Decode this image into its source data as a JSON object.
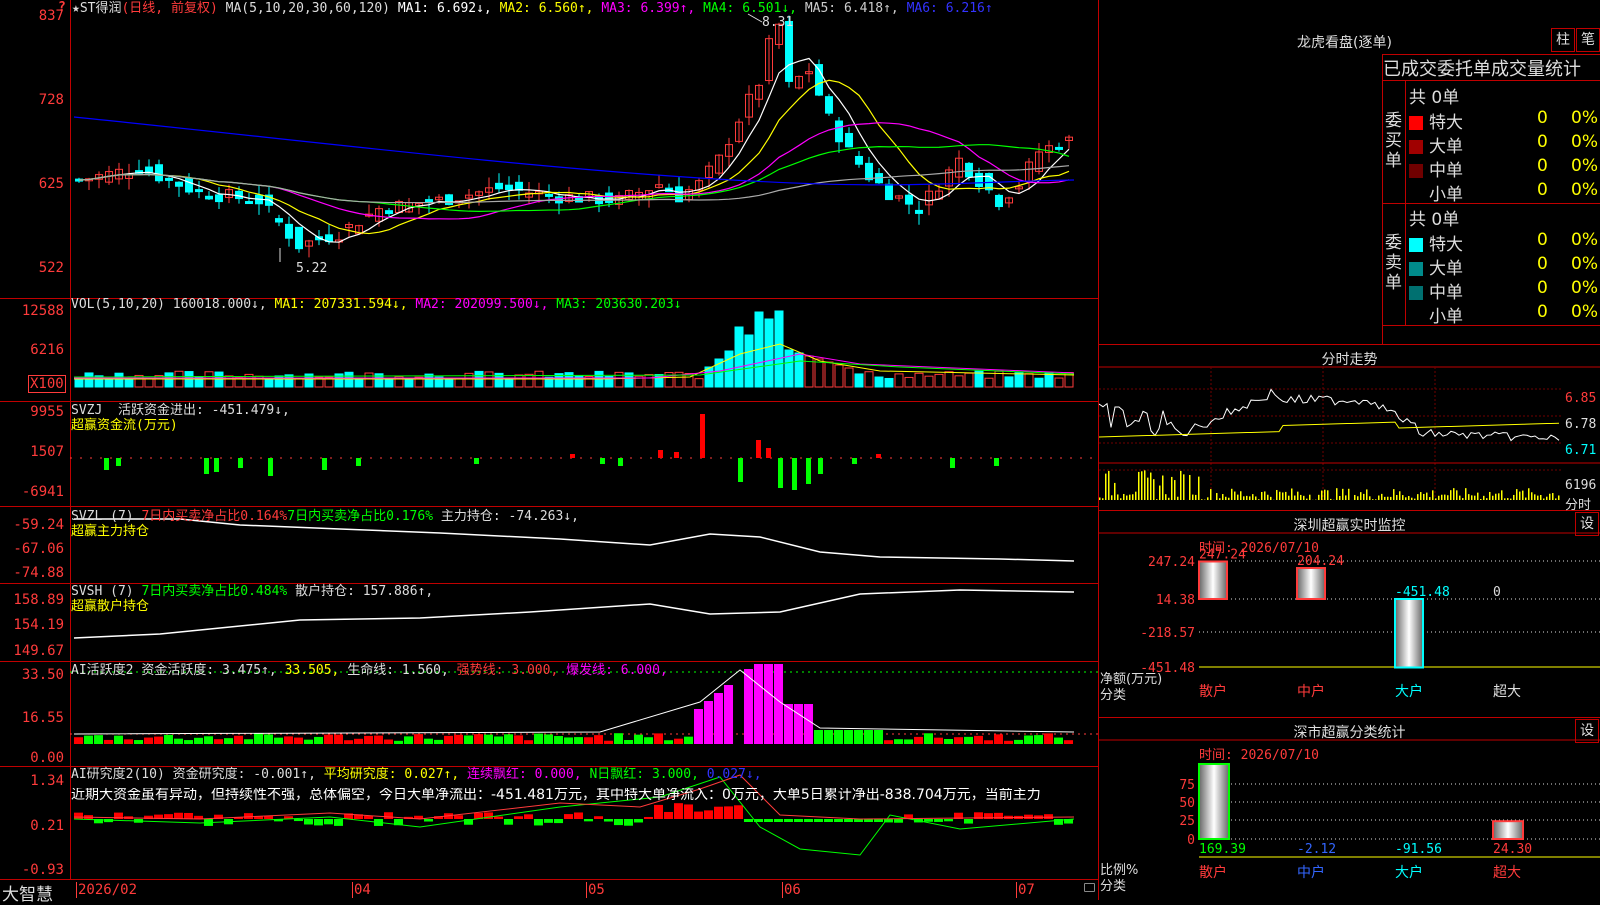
{
  "corner_mark": "?",
  "main": {
    "title_prefix": "★ST得润",
    "period": "(日线, 前复权)",
    "ma_def": "MA(5,10,20,30,60,120)",
    "ma1": "MA1: 6.692↓,",
    "ma2": "MA2: 6.560↑,",
    "ma3": "MA3: 6.399↑,",
    "ma4": "MA4: 6.501↓,",
    "ma5": "MA5: 6.418↑,",
    "ma6": "MA6: 6.216↑",
    "y_labels": [
      "837",
      "728",
      "625",
      "522"
    ],
    "high_label": "8.31",
    "low_label": "5.22",
    "colors": {
      "ma1": "#ffffff",
      "ma2": "#ffff00",
      "ma3": "#ff00ff",
      "ma4": "#00ff00",
      "ma5": "#aaaaaa",
      "ma6": "#0000ff",
      "up": "#ff3b3b",
      "down": "#00ffff"
    }
  },
  "vol": {
    "def": "VOL(5,10,20)",
    "value": "160018.000↓,",
    "ma1": "MA1: 207331.594↓,",
    "ma2": "MA2: 202099.500↓,",
    "ma3": "MA3: 203630.203↓",
    "y_labels": [
      "12588",
      "6216"
    ],
    "unit": "X100"
  },
  "svzj": {
    "name": "SVZJ",
    "label": "活跃资金进出: -451.479↓,",
    "sub": "超赢资金流(万元)",
    "y_labels": [
      "9955",
      "1507",
      "-6941"
    ]
  },
  "svzl": {
    "name": "SVZL (7)",
    "t1": "7日内买卖净占比0.164%",
    "t2": "7日内买卖净占比0.176%",
    "t3": "主力持仓: -74.263↓,",
    "sub": "超赢主力持仓",
    "y_labels": [
      "-59.24",
      "-67.06",
      "-74.88"
    ]
  },
  "svsh": {
    "name": "SVSH (7)",
    "t1": "7日内买卖净占比0.484%",
    "t2": "散户持仓: 157.886↑,",
    "sub": "超赢散户持仓",
    "y_labels": [
      "158.89",
      "154.19",
      "149.67"
    ]
  },
  "ai1": {
    "name": "AI活跃度2",
    "t1": "资金活跃度: 3.475↑,",
    "t2": "33.505,",
    "t3": "生命线: 1.560,",
    "t4": "强势线: 3.000,",
    "t5": "爆发线: 6.000,",
    "y_labels": [
      "33.50",
      "16.55",
      "0.00"
    ]
  },
  "ai2": {
    "name": "AI研究度2(10)",
    "t1": "资金研究度: -0.001↑,",
    "t2": "平均研究度: 0.027↑,",
    "t3": "连续飘红: 0.000,",
    "t4": "N日飘红: 3.000,",
    "t5": "0.027↓,",
    "comment": "近期大资金虽有异动，但持续性不强，总体偏空，今日大单净流出：-451.481万元，其中特大单净流入：0万元，大单5日累计净出-838.704万元，当前主力",
    "y_labels": [
      "1.34",
      "0.21",
      "-0.93"
    ]
  },
  "xaxis": {
    "brand": "大智慧",
    "labels": [
      "2026/02",
      "04",
      "05",
      "06",
      "07"
    ]
  },
  "lhb": {
    "title": "龙虎看盘(逐单)",
    "btn1": "柱",
    "btn2": "笔",
    "header": "已成交委托单成交量统计",
    "buy_label": "委买单",
    "sell_label": "委卖单",
    "buy_total": "共 0单",
    "sell_total": "共 0单",
    "buy_rows": [
      {
        "name": "特大",
        "v": "0",
        "p": "0%",
        "c": "#ff0000"
      },
      {
        "name": "大单",
        "v": "0",
        "p": "0%",
        "c": "#a00000"
      },
      {
        "name": "中单",
        "v": "0",
        "p": "0%",
        "c": "#700000"
      },
      {
        "name": "小单",
        "v": "0",
        "p": "0%",
        "c": "#000000"
      }
    ],
    "sell_rows": [
      {
        "name": "特大",
        "v": "0",
        "p": "0%",
        "c": "#00ffff"
      },
      {
        "name": "大单",
        "v": "0",
        "p": "0%",
        "c": "#008b8b"
      },
      {
        "name": "中单",
        "v": "0",
        "p": "0%",
        "c": "#007070"
      },
      {
        "name": "小单",
        "v": "0",
        "p": "0%",
        "c": "#000000"
      }
    ]
  },
  "intraday": {
    "title": "分时走势",
    "y_labels": [
      "6.85",
      "6.78",
      "6.71"
    ],
    "vol_label": "6196",
    "vol_unit": "分时"
  },
  "monitor": {
    "title": "深圳超赢实时监控",
    "btn": "设",
    "time": "时间: 2026/07/10",
    "y_labels": [
      "247.24",
      "14.38",
      "-218.57",
      "-451.48"
    ],
    "unit1": "净额(万元)",
    "unit2": "分类",
    "values": [
      {
        "name": "散户",
        "label": "247.24",
        "v": 247.24
      },
      {
        "name": "中户",
        "label": "204.24",
        "v": 204.24
      },
      {
        "name": "大户",
        "label": "-451.48",
        "v": -451.48
      },
      {
        "name": "超大",
        "label": "0",
        "v": 0
      }
    ]
  },
  "stats": {
    "title": "深市超赢分类统计",
    "btn": "设",
    "time": "时间: 2026/07/10",
    "y_labels": [
      "75",
      "50",
      "25",
      "0"
    ],
    "unit1": "比例%",
    "unit2": "分类",
    "values": [
      {
        "name": "散户",
        "label": "169.39",
        "v": 169.39
      },
      {
        "name": "中户",
        "label": "-2.12",
        "v": -2.12
      },
      {
        "name": "大户",
        "label": "-91.56",
        "v": -91.56
      },
      {
        "name": "超大",
        "label": "24.30",
        "v": 24.3
      }
    ]
  }
}
